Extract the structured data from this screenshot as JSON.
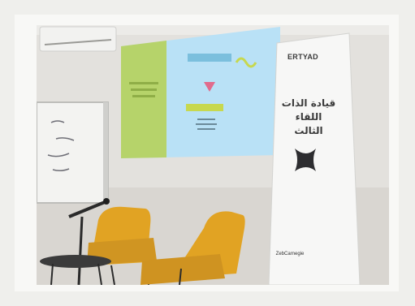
{
  "scene": {
    "banner": {
      "brand": "ERTYAD",
      "title_line1": "قيادة الذات",
      "title_line2": "اللقاء الثالث",
      "sponsor": "ZebCarnegie"
    },
    "colors": {
      "background": "#efefec",
      "chair": "#e1a323",
      "screen_green": "#b6d36a",
      "screen_blue": "#b9e1f6"
    }
  }
}
